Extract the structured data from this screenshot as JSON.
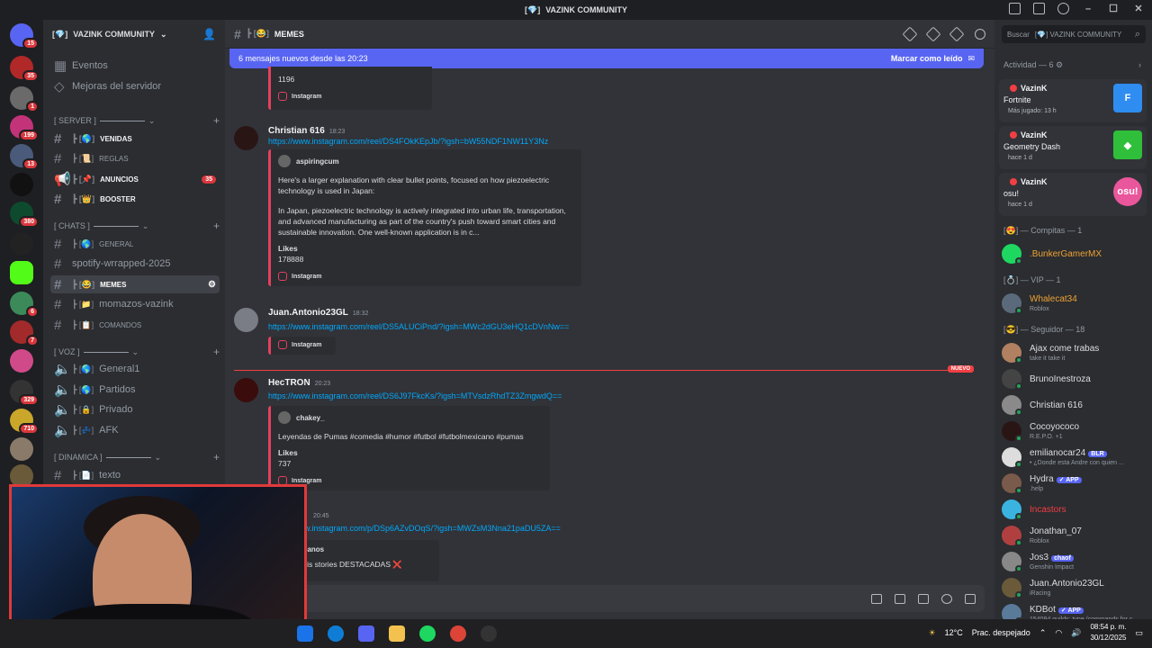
{
  "window": {
    "title": "VAZINK COMMUNITY",
    "title_prefix": "[💎]"
  },
  "servers": [
    {
      "badge": "15"
    },
    {
      "badge": "35"
    },
    {
      "badge": "1"
    },
    {
      "badge": "199"
    },
    {
      "badge": "13"
    },
    {
      "badge": ""
    },
    {
      "badge": "380"
    },
    {
      "badge": ""
    },
    {
      "badge": ""
    },
    {
      "badge": "6"
    },
    {
      "badge": "7"
    },
    {
      "badge": ""
    },
    {
      "badge": "329"
    },
    {
      "badge": "710"
    },
    {
      "badge": ""
    },
    {
      "badge": ""
    }
  ],
  "guild": {
    "name": "VAZINK COMMUNITY",
    "icon": "[💎]"
  },
  "sidebar": {
    "top_items": [
      "Eventos",
      "Mejoras del servidor"
    ],
    "categories": [
      {
        "name": "[ SERVER ]",
        "channels": [
          {
            "name": "VENIDAS",
            "bold": true
          },
          {
            "name": "REGLAS",
            "bold": false
          },
          {
            "name": "ANUNCIOS",
            "bold": true,
            "badge": "35"
          },
          {
            "name": "BOOSTER",
            "bold": true
          }
        ]
      },
      {
        "name": "[ CHATS ]",
        "channels": [
          {
            "name": "GENERAL"
          },
          {
            "name": "spotify-wrrapped-2025"
          },
          {
            "name": "MEMES",
            "active": true
          },
          {
            "name": "momazos-vazink"
          },
          {
            "name": "COMANDOS"
          }
        ]
      },
      {
        "name": "[ VOZ ]",
        "channels": [
          {
            "name": "General1"
          },
          {
            "name": "Partidos"
          },
          {
            "name": "Privado"
          },
          {
            "name": "AFK"
          }
        ]
      },
      {
        "name": "[ DINAMICA ]",
        "channels": [
          {
            "name": "texto"
          }
        ]
      }
    ]
  },
  "chat": {
    "channel": "MEMES",
    "new_banner": "6 mensajes nuevos desde las 20:23",
    "mark_read": "Marcar como leído",
    "top_embed": {
      "likes_value": "1196",
      "footer": "Instagram"
    },
    "messages": [
      {
        "author": "Christian 616",
        "time": "18:23",
        "link": "https://www.instagram.com/reel/DS4FOkKEpJb/?igsh=bW55NDF1NW11Y3Nz",
        "embed": {
          "author": "aspiringcum",
          "text1": "Here's a larger explanation with clear bullet points, focused on how piezoelectric technology is used in Japan:",
          "text2": "In Japan, piezoelectric technology is actively integrated into urban life, transportation, and advanced manufacturing as part of the country's push toward smart cities and sustainable innovation. One well-known application is in c...",
          "likes_label": "Likes",
          "likes": "178888",
          "footer": "Instagram"
        }
      },
      {
        "author": "Juan.Antonio23GL",
        "time": "18:32",
        "link": "https://www.instagram.com/reel/DS5ALUCiPnd/?igsh=MWc2dGU3eHQ1cDVnNw==",
        "embed": {
          "footer": "Instagram"
        }
      },
      {
        "author": "HecTRON",
        "time": "20:23",
        "link": "https://www.instagram.com/reel/DS6J97FkcKs/?igsh=MTVsdzRhdTZ3ZmgwdQ==",
        "embed": {
          "author": "chakey_",
          "text1": "Leyendas de Pumas #comedia #humor #futbol #futbolmexicano #pumas",
          "likes_label": "Likes",
          "likes": "737",
          "footer": "Instagram"
        }
      },
      {
        "author": "",
        "time": "20:45",
        "link": "https://www.instagram.com/p/DSp6AZvDOqS/?igsh=MWZsM3Nna21paDU5ZA==",
        "embed": {
          "author": "cioshispanos",
          "text1": "VEAS mis stories DESTACADAS ❌"
        }
      }
    ],
    "new_divider": "NUEVO"
  },
  "members": {
    "search_placeholder": "Buscar",
    "search_scope": "[💎] VAZINK COMMUNITY",
    "activity_header": "Actividad — 6",
    "activities": [
      {
        "name": "VazinK",
        "game": "Fortnite",
        "status": "Más jugado: 13 h",
        "color": "#2f8cf0",
        "glyph": "F"
      },
      {
        "name": "VazinK",
        "game": "Geometry Dash",
        "status": "hace 1 d",
        "color": "#2fbf3a",
        "glyph": "◆"
      },
      {
        "name": "VazinK",
        "game": "osu!",
        "status": "hace 1 d",
        "color": "#e9569b",
        "glyph": "osu!"
      }
    ],
    "groups": [
      {
        "label": "[😍] — Compitas — 1",
        "members": [
          {
            "name": ".BunkerGamerMX",
            "status": "",
            "color": "#f0a232"
          }
        ]
      },
      {
        "label": "[💍] — VIP — 1",
        "members": [
          {
            "name": "Whalecat34",
            "status": "Roblox",
            "color": "#f0a232"
          }
        ]
      },
      {
        "label": "[😎] — Seguidor — 18",
        "members": [
          {
            "name": "Ajax come trabas",
            "status": "take it take it",
            "color": "#dbdee1"
          },
          {
            "name": "BrunoInestroza",
            "status": "",
            "color": "#dbdee1"
          },
          {
            "name": "Christian 616",
            "status": "",
            "color": "#dbdee1"
          },
          {
            "name": "Cocoyococo",
            "status": "R.E.P.O. +1",
            "color": "#dbdee1"
          },
          {
            "name": "emilianocar24",
            "tag": "BLR",
            "status": "• ¿Donde esta Andre con quien ...",
            "color": "#dbdee1"
          },
          {
            "name": "Hydra",
            "tag": "✓ APP",
            "status": ".help",
            "color": "#dbdee1"
          },
          {
            "name": "Incastors",
            "status": "",
            "color": "#f23f43"
          },
          {
            "name": "Jonathan_07",
            "status": "Roblox",
            "color": "#dbdee1"
          },
          {
            "name": "Jos3",
            "tag": "chaof",
            "status": "Genshin Impact",
            "color": "#dbdee1"
          },
          {
            "name": "Juan.Antonio23GL",
            "status": "iRacing",
            "color": "#dbdee1"
          },
          {
            "name": "KDBot",
            "tag": "✓ APP",
            "status": "154094 guilds; type /commands for c",
            "color": "#dbdee1"
          }
        ]
      }
    ]
  },
  "taskbar": {
    "weather": "12°C",
    "weather_desc": "Prac. despejado",
    "time": "08:54 p. m.",
    "date": "30/12/2025"
  }
}
